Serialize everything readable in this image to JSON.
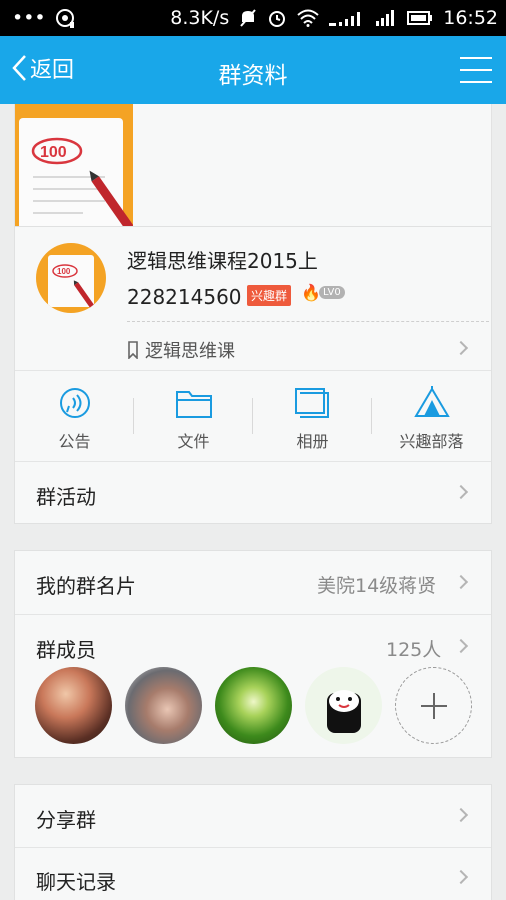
{
  "status_bar": {
    "dots": "•••",
    "speed": "8.3K/s",
    "time": "16:52"
  },
  "nav": {
    "back_label": "返回",
    "title": "群资料"
  },
  "group": {
    "name": "逻辑思维课程2015上",
    "id": "228214560",
    "tag": "兴趣群",
    "level": "LV0",
    "tribe_name": "逻辑思维课"
  },
  "actions": [
    {
      "label": "公告",
      "icon": "announcement-icon"
    },
    {
      "label": "文件",
      "icon": "folder-icon"
    },
    {
      "label": "相册",
      "icon": "album-icon"
    },
    {
      "label": "兴趣部落",
      "icon": "tribe-icon"
    }
  ],
  "rows": {
    "activity": "群活动",
    "my_card_label": "我的群名片",
    "my_card_value": "美院14级蒋贤",
    "members_label": "群成员",
    "members_count": "125人",
    "share": "分享群",
    "chat_history": "聊天记录"
  },
  "colors": {
    "nav_bg": "#19a7e9",
    "accent": "#1a9be0",
    "tag_bg": "#ee5a3c"
  }
}
